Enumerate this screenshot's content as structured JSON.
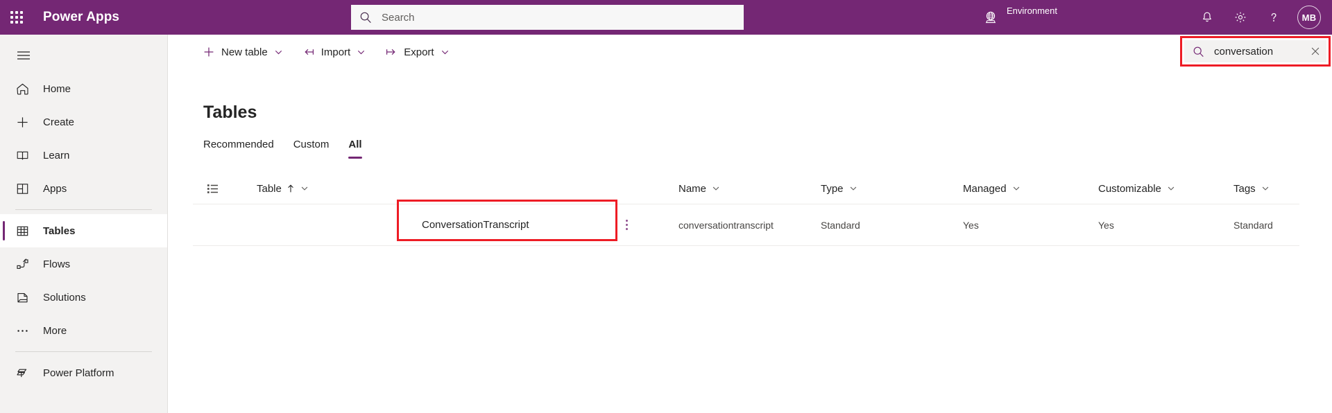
{
  "suite": {
    "brand": "Power Apps",
    "waffle_icon": "waffle-icon",
    "search": {
      "placeholder": "Search",
      "value": "",
      "icon": "search-icon"
    },
    "environment": {
      "label": "Environment",
      "icon": "globe-icon"
    },
    "actions": [
      {
        "name": "notifications-button",
        "icon": "bell-icon"
      },
      {
        "name": "settings-button",
        "icon": "gear-icon"
      },
      {
        "name": "help-button",
        "icon": "question-icon"
      }
    ],
    "avatar": {
      "initials": "MB",
      "name": "avatar"
    }
  },
  "sidebar": {
    "hamburger_icon": "hamburger-icon",
    "items": [
      {
        "label": "Home",
        "icon": "home-icon",
        "selected": false
      },
      {
        "label": "Create",
        "icon": "plus-icon",
        "selected": false
      },
      {
        "label": "Learn",
        "icon": "book-icon",
        "selected": false
      },
      {
        "label": "Apps",
        "icon": "apps-icon",
        "selected": false
      },
      {
        "label": "Tables",
        "icon": "table-icon",
        "selected": true
      },
      {
        "label": "Flows",
        "icon": "flow-icon",
        "selected": false
      },
      {
        "label": "Solutions",
        "icon": "solutions-icon",
        "selected": false
      },
      {
        "label": "More",
        "icon": "ellipsis-icon",
        "selected": false
      },
      {
        "label": "Power Platform",
        "icon": "power-platform-icon",
        "selected": false
      }
    ]
  },
  "command_bar": {
    "buttons": [
      {
        "label": "New table",
        "icon": "plus-icon",
        "chevron": true
      },
      {
        "label": "Import",
        "icon": "import-arrow-icon",
        "chevron": true
      },
      {
        "label": "Export",
        "icon": "export-arrow-icon",
        "chevron": true
      }
    ],
    "search": {
      "value": "conversation",
      "placeholder": "Search",
      "icon": "search-icon",
      "clear_icon": "close-icon",
      "highlighted": true
    }
  },
  "main": {
    "title": "Tables",
    "tabs": [
      {
        "label": "Recommended",
        "active": false
      },
      {
        "label": "Custom",
        "active": false
      },
      {
        "label": "All",
        "active": true
      }
    ],
    "grid": {
      "view_icon": "list-view-icon",
      "columns": [
        {
          "label": "Table",
          "sorted": "asc",
          "sort_icon": "arrow-up-icon",
          "chevron": true
        },
        {
          "label": "Name",
          "chevron": true
        },
        {
          "label": "Type",
          "chevron": true
        },
        {
          "label": "Managed",
          "chevron": true
        },
        {
          "label": "Customizable",
          "chevron": true
        },
        {
          "label": "Tags",
          "chevron": true
        }
      ],
      "rows": [
        {
          "table": "ConversationTranscript",
          "name": "conversationtranscript",
          "type": "Standard",
          "managed": "Yes",
          "customizable": "Yes",
          "tags": "Standard",
          "overflow_icon": "more-vertical-icon",
          "highlighted": true
        }
      ]
    }
  },
  "colors": {
    "brand_purple": "#742774",
    "accent_purple": "#742774",
    "annotation_red": "#ee1c25",
    "sidebar_bg": "#f3f2f1"
  }
}
